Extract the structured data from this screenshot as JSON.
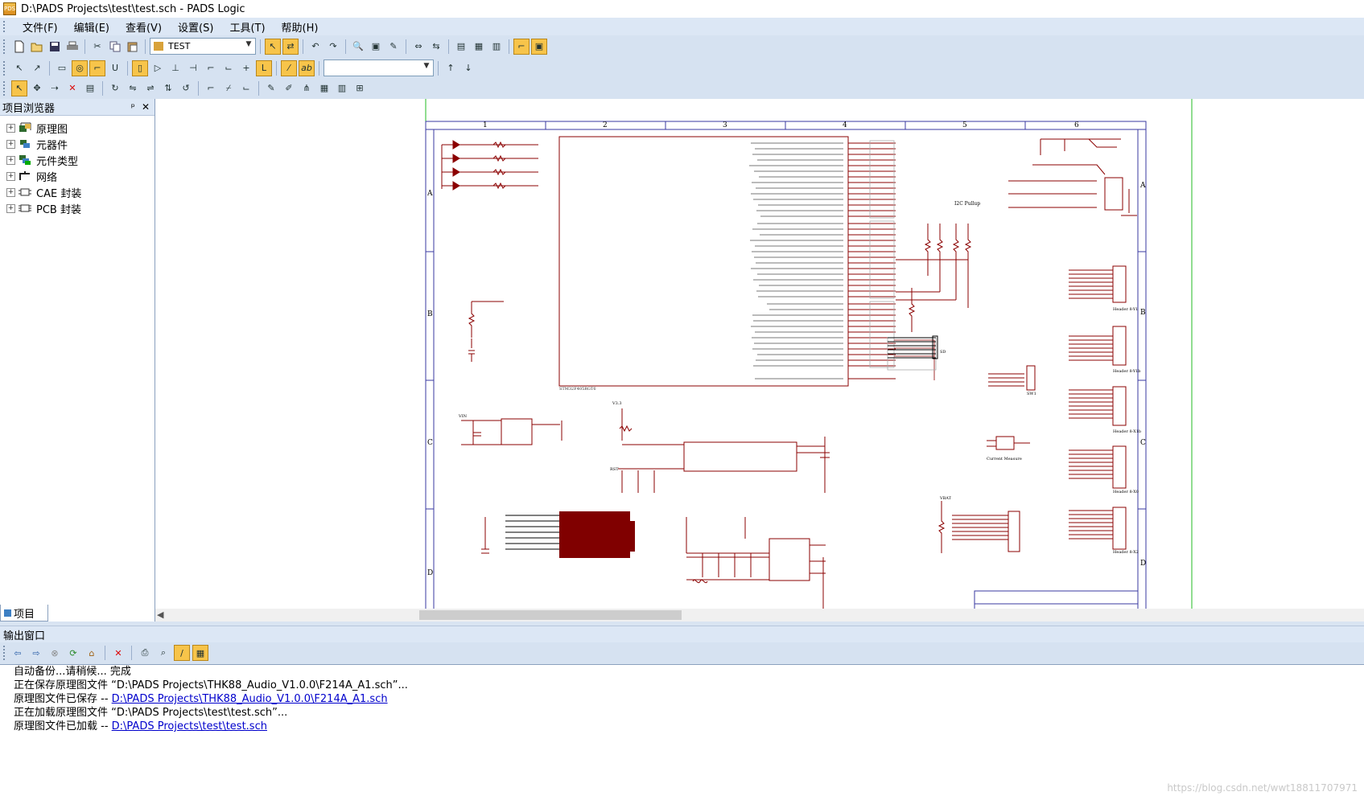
{
  "window": {
    "title": "D:\\PADS Projects\\test\\test.sch - PADS Logic",
    "app_icon": "pads-logic-icon"
  },
  "menu": [
    {
      "label": "文件(F)"
    },
    {
      "label": "编辑(E)"
    },
    {
      "label": "查看(V)"
    },
    {
      "label": "设置(S)"
    },
    {
      "label": "工具(T)"
    },
    {
      "label": "帮助(H)"
    }
  ],
  "toolbar": {
    "sheet_combo_value": "TEST",
    "second_combo_value": ""
  },
  "project_browser": {
    "title": "项目浏览器",
    "pin_label": "ᵖ",
    "close_label": "✕",
    "items": [
      {
        "label": "原理图",
        "icon": "schematic-icon"
      },
      {
        "label": "元器件",
        "icon": "part-icon"
      },
      {
        "label": "元件类型",
        "icon": "part-type-icon"
      },
      {
        "label": "网络",
        "icon": "net-icon"
      },
      {
        "label": "CAE 封装",
        "icon": "cae-decal-icon"
      },
      {
        "label": "PCB 封装",
        "icon": "pcb-decal-icon"
      }
    ],
    "tab_label": "项目"
  },
  "schematic": {
    "columns": [
      "1",
      "2",
      "3",
      "4",
      "5",
      "6"
    ],
    "rows": [
      "A",
      "B",
      "C",
      "D"
    ],
    "mcu_title": "STM32F405RGT6",
    "labels": {
      "i2c": "I2C Pullup",
      "sd": "SD",
      "header_y1": "Header 8-Y1",
      "header_y1b": "Header 8-Y1b",
      "header_x1b": "Header 8-X1b",
      "header_x0": "Header 8-X0",
      "header_x2": "Header 8-X2",
      "current_measure": "Current Measure",
      "sw1": "SW1",
      "rst": "RST",
      "v33": "V3.3",
      "vin": "VIN",
      "vbat": "VBAT"
    }
  },
  "output": {
    "title": "输出窗口",
    "lines": [
      {
        "text": "自动备份...请稍候... 完成",
        "link": ""
      },
      {
        "text": "正在保存原理图文件 “D:\\PADS Projects\\THK88_Audio_V1.0.0\\F214A_A1.sch”...",
        "link": ""
      },
      {
        "text": "原理图文件已保存 -- ",
        "link": "D:\\PADS Projects\\THK88_Audio_V1.0.0\\F214A_A1.sch"
      },
      {
        "text": "正在加载原理图文件 “D:\\PADS Projects\\test\\test.sch”...",
        "link": ""
      },
      {
        "text": "原理图文件已加载 -- ",
        "link": "D:\\PADS Projects\\test\\test.sch"
      }
    ]
  },
  "watermark": "https://blog.csdn.net/wwt18811707971"
}
